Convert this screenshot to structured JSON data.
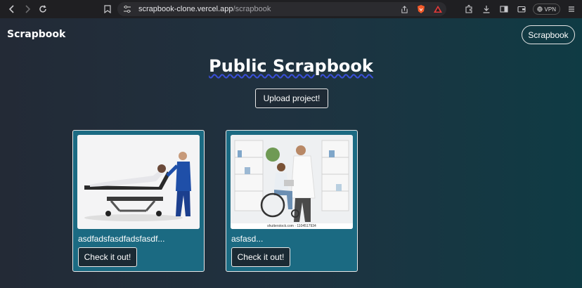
{
  "browser": {
    "url_host": "scrapbook-clone.vercel.app",
    "url_path": "/scrapbook",
    "vpn_label": "VPN"
  },
  "header": {
    "brand": "Scrapbook",
    "nav_button": "Scrapbook"
  },
  "main": {
    "title": "Public Scrapbook",
    "upload_label": "Upload project!"
  },
  "cards": [
    {
      "name": "asdfadsfasdfadsfasdf...",
      "button": "Check it out!",
      "image": "patient-on-stretcher-photo"
    },
    {
      "name": "asfasd...",
      "button": "Check it out!",
      "image": "doctor-and-wheelchair-patient-photo",
      "watermark": "shutterstock.com · 1104517934"
    }
  ],
  "colors": {
    "card_bg": "#1b6a82",
    "title_underline": "#3a4fd8"
  }
}
